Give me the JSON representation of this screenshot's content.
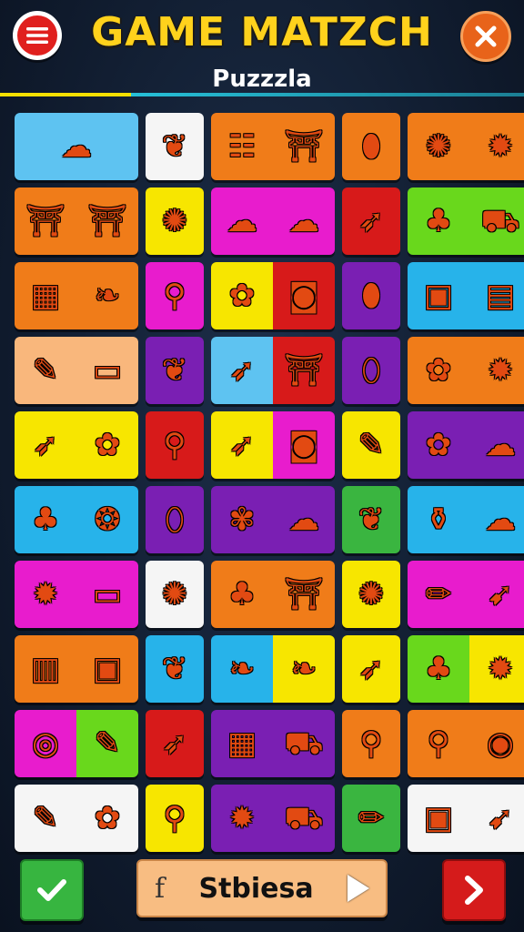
{
  "header": {
    "title": "GAME MATZCH",
    "subtitle": "Puzzzla"
  },
  "colors": {
    "yellow": "#f7e600",
    "orange": "#f07c19",
    "red": "#d71a1a",
    "pink": "#e81ccd",
    "purple": "#7a1fb3",
    "green": "#3ab540",
    "lime": "#69d81c",
    "blue": "#27b3ea",
    "skyblue": "#5ec3f1",
    "peach": "#f9b77c",
    "white": "#f5f5f5"
  },
  "board": {
    "rows": [
      [
        {
          "span": 2,
          "bg": [
            "skyblue"
          ],
          "icons": [
            "cloud-icon"
          ]
        },
        {
          "span": 1,
          "bg": [
            "white"
          ],
          "icons": [
            "eggplant-icon"
          ]
        },
        {
          "span": 2,
          "bg": [
            "orange"
          ],
          "icons": [
            "bench-icon",
            "temple-icon"
          ]
        },
        {
          "span": 1,
          "bg": [
            "orange"
          ],
          "icons": [
            "lemon-icon"
          ]
        },
        {
          "span": 2,
          "bg": [
            "orange"
          ],
          "icons": [
            "orange-blob-icon",
            "cookie-icon"
          ]
        }
      ],
      [
        {
          "span": 2,
          "bg": [
            "orange"
          ],
          "icons": [
            "temple-icon",
            "temple-icon"
          ]
        },
        {
          "span": 1,
          "bg": [
            "yellow"
          ],
          "icons": [
            "orange-blob-icon"
          ]
        },
        {
          "span": 2,
          "bg": [
            "pink"
          ],
          "icons": [
            "cloud-icon",
            "sheep-icon"
          ]
        },
        {
          "span": 1,
          "bg": [
            "red"
          ],
          "icons": [
            "carrot-icon"
          ]
        },
        {
          "span": 2,
          "bg": [
            "lime"
          ],
          "icons": [
            "tree-icon",
            "truck-icon"
          ]
        }
      ],
      [
        {
          "span": 2,
          "bg": [
            "orange"
          ],
          "icons": [
            "calendar-icon",
            "leaf-icon"
          ]
        },
        {
          "span": 1,
          "bg": [
            "pink"
          ],
          "icons": [
            "paddle-icon"
          ]
        },
        {
          "span": 2,
          "bg": [
            "yellow",
            "red"
          ],
          "icons": [
            "bush-icon",
            "radio-icon"
          ]
        },
        {
          "span": 1,
          "bg": [
            "purple"
          ],
          "icons": [
            "lemon-icon"
          ]
        },
        {
          "span": 2,
          "bg": [
            "blue"
          ],
          "icons": [
            "phone-icon",
            "tank-icon"
          ]
        }
      ],
      [
        {
          "span": 2,
          "bg": [
            "peach"
          ],
          "icons": [
            "pencil-icon",
            "battery-icon"
          ]
        },
        {
          "span": 1,
          "bg": [
            "purple"
          ],
          "icons": [
            "eggplant-icon"
          ]
        },
        {
          "span": 2,
          "bg": [
            "skyblue",
            "red"
          ],
          "icons": [
            "carrot-icon",
            "temple-icon"
          ]
        },
        {
          "span": 1,
          "bg": [
            "purple"
          ],
          "icons": [
            "cotton-candy-icon"
          ]
        },
        {
          "span": 2,
          "bg": [
            "orange"
          ],
          "icons": [
            "bush-icon",
            "cookie-icon"
          ]
        }
      ],
      [
        {
          "span": 2,
          "bg": [
            "yellow"
          ],
          "icons": [
            "carrot-icon",
            "bush-icon"
          ]
        },
        {
          "span": 1,
          "bg": [
            "red"
          ],
          "icons": [
            "paddle-icon"
          ]
        },
        {
          "span": 2,
          "bg": [
            "yellow",
            "pink"
          ],
          "icons": [
            "carrot-icon",
            "radio-icon"
          ]
        },
        {
          "span": 1,
          "bg": [
            "yellow"
          ],
          "icons": [
            "pencil-icon"
          ]
        },
        {
          "span": 2,
          "bg": [
            "purple"
          ],
          "icons": [
            "bush-icon",
            "cloud-icon"
          ]
        }
      ],
      [
        {
          "span": 2,
          "bg": [
            "blue"
          ],
          "icons": [
            "tree-icon",
            "bubble-icon"
          ]
        },
        {
          "span": 1,
          "bg": [
            "purple"
          ],
          "icons": [
            "cotton-candy-icon"
          ]
        },
        {
          "span": 2,
          "bg": [
            "purple"
          ],
          "icons": [
            "pink-blob-icon",
            "cloud-icon"
          ]
        },
        {
          "span": 1,
          "bg": [
            "green"
          ],
          "icons": [
            "eggplant-icon"
          ]
        },
        {
          "span": 2,
          "bg": [
            "blue"
          ],
          "icons": [
            "jar-icon",
            "cloud-icon"
          ]
        }
      ],
      [
        {
          "span": 2,
          "bg": [
            "pink"
          ],
          "icons": [
            "cookie-icon",
            "battery-icon"
          ]
        },
        {
          "span": 1,
          "bg": [
            "white"
          ],
          "icons": [
            "orange-blob-icon"
          ]
        },
        {
          "span": 2,
          "bg": [
            "orange"
          ],
          "icons": [
            "tree-icon",
            "temple-icon"
          ]
        },
        {
          "span": 1,
          "bg": [
            "yellow"
          ],
          "icons": [
            "orange-blob-icon"
          ]
        },
        {
          "span": 2,
          "bg": [
            "pink"
          ],
          "icons": [
            "crayon-icon",
            "rocket-icon"
          ]
        }
      ],
      [
        {
          "span": 2,
          "bg": [
            "orange"
          ],
          "icons": [
            "grid-icon",
            "phone-icon"
          ]
        },
        {
          "span": 1,
          "bg": [
            "blue"
          ],
          "icons": [
            "eggplant-icon"
          ]
        },
        {
          "span": 2,
          "bg": [
            "blue",
            "yellow"
          ],
          "icons": [
            "leaf-icon",
            "leaf-icon"
          ]
        },
        {
          "span": 1,
          "bg": [
            "yellow"
          ],
          "icons": [
            "carrot-icon"
          ]
        },
        {
          "span": 2,
          "bg": [
            "lime",
            "yellow"
          ],
          "icons": [
            "tree-icon",
            "cookie-icon"
          ]
        }
      ],
      [
        {
          "span": 2,
          "bg": [
            "pink",
            "lime"
          ],
          "icons": [
            "spiral-icon",
            "pencil-icon"
          ]
        },
        {
          "span": 1,
          "bg": [
            "red"
          ],
          "icons": [
            "carrot-icon"
          ]
        },
        {
          "span": 2,
          "bg": [
            "purple"
          ],
          "icons": [
            "calendar-icon",
            "truck-icon"
          ]
        },
        {
          "span": 1,
          "bg": [
            "orange"
          ],
          "icons": [
            "paddle-icon"
          ]
        },
        {
          "span": 2,
          "bg": [
            "orange"
          ],
          "icons": [
            "paddle-icon",
            "ball-icon"
          ]
        }
      ],
      [
        {
          "span": 2,
          "bg": [
            "white"
          ],
          "icons": [
            "pencil-icon",
            "bush-icon"
          ]
        },
        {
          "span": 1,
          "bg": [
            "yellow"
          ],
          "icons": [
            "paddle-icon"
          ]
        },
        {
          "span": 2,
          "bg": [
            "purple"
          ],
          "icons": [
            "cookie-icon",
            "truck-icon"
          ]
        },
        {
          "span": 1,
          "bg": [
            "green"
          ],
          "icons": [
            "crayon-icon"
          ]
        },
        {
          "span": 2,
          "bg": [
            "white"
          ],
          "icons": [
            "phone-icon",
            "rocket-icon"
          ]
        }
      ]
    ]
  },
  "icon_glyphs": {
    "cloud-icon": "☁",
    "eggplant-icon": "❦",
    "bench-icon": "☷",
    "temple-icon": "⛩",
    "lemon-icon": "⬮",
    "orange-blob-icon": "✺",
    "cookie-icon": "✹",
    "carrot-icon": "➶",
    "sheep-icon": "☁",
    "tree-icon": "♣",
    "truck-icon": "⛟",
    "calendar-icon": "▦",
    "leaf-icon": "❧",
    "paddle-icon": "⚲",
    "bush-icon": "✿",
    "radio-icon": "◙",
    "phone-icon": "▣",
    "tank-icon": "▤",
    "pencil-icon": "✎",
    "battery-icon": "▭",
    "cotton-candy-icon": "⬯",
    "bubble-icon": "❂",
    "pink-blob-icon": "✾",
    "jar-icon": "⚱",
    "crayon-icon": "✏",
    "rocket-icon": "➹",
    "grid-icon": "▥",
    "spiral-icon": "◎",
    "ball-icon": "◉"
  },
  "footer": {
    "share_icon_letter": "f",
    "share_label": "Stbiesa"
  }
}
